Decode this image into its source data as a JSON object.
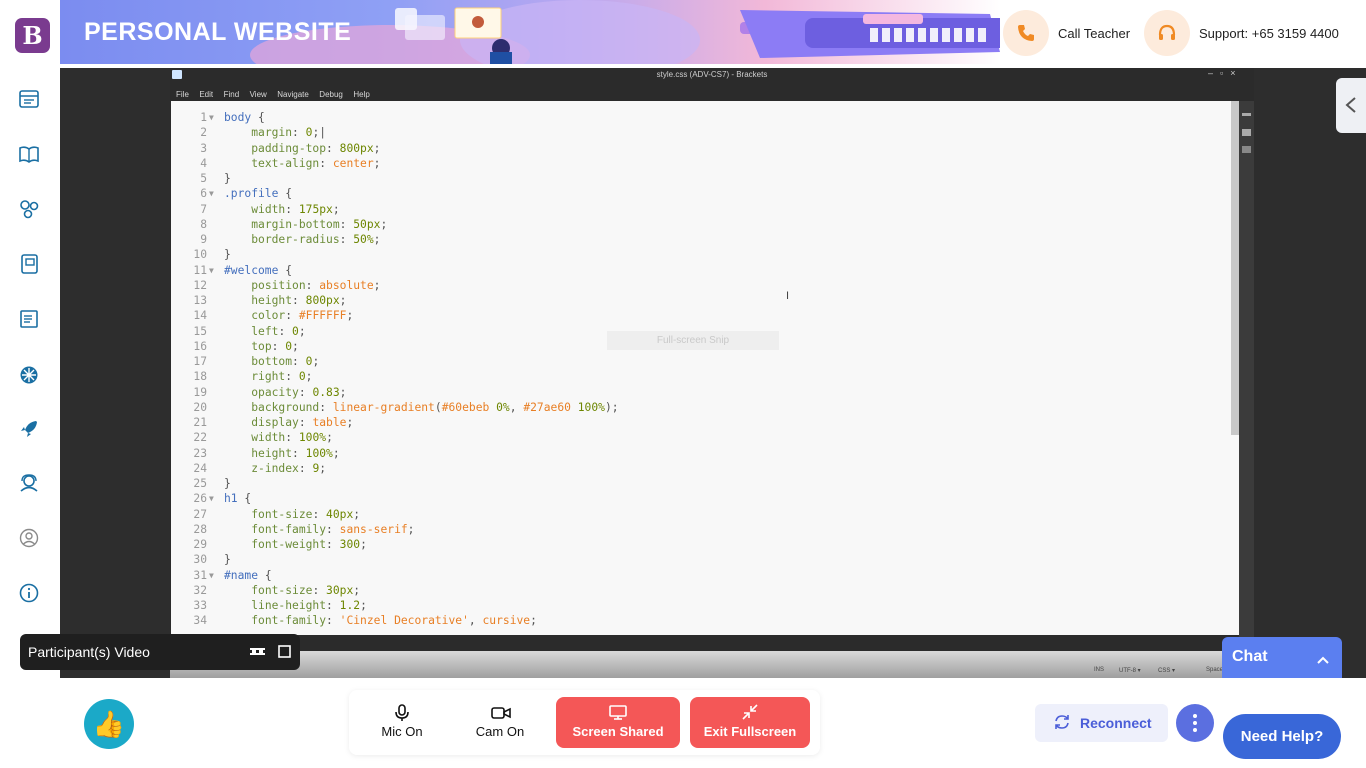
{
  "header": {
    "banner_title": "PERSONAL WEBSITE",
    "call_teacher_label": "Call Teacher",
    "support_label": "Support: +65 3159 4400"
  },
  "sidebar": {
    "items": [
      {
        "icon": "dashboard-icon"
      },
      {
        "icon": "book-icon"
      },
      {
        "icon": "cells-icon"
      },
      {
        "icon": "notebook-icon"
      },
      {
        "icon": "document-list-icon"
      },
      {
        "icon": "snowflake-icon"
      },
      {
        "icon": "rocket-icon"
      },
      {
        "icon": "support-agent-icon"
      },
      {
        "icon": "profile-icon"
      },
      {
        "icon": "info-icon"
      }
    ]
  },
  "brackets": {
    "window_title": "style.css (ADV-CS7) - Brackets",
    "menu": [
      "File",
      "Edit",
      "Find",
      "View",
      "Navigate",
      "Debug",
      "Help"
    ],
    "status": {
      "ins": "INS",
      "encoding": "UTF-8 ▾",
      "language": "CSS ▾",
      "spaces": "Space"
    },
    "snip_overlay": "Full-screen Snip"
  },
  "code_lines": [
    {
      "n": "1",
      "fold": "▼",
      "tokens": [
        [
          "sel",
          "body "
        ],
        [
          "punct",
          "{"
        ]
      ]
    },
    {
      "n": "2",
      "fold": "",
      "tokens": [
        [
          "punct",
          "    "
        ],
        [
          "prop",
          "margin"
        ],
        [
          "punct",
          ": "
        ],
        [
          "num",
          "0"
        ],
        [
          "punct",
          ";|"
        ]
      ]
    },
    {
      "n": "3",
      "fold": "",
      "tokens": [
        [
          "punct",
          "    "
        ],
        [
          "prop",
          "padding-top"
        ],
        [
          "punct",
          ": "
        ],
        [
          "num",
          "800px"
        ],
        [
          "punct",
          ";"
        ]
      ]
    },
    {
      "n": "4",
      "fold": "",
      "tokens": [
        [
          "punct",
          "    "
        ],
        [
          "prop",
          "text-align"
        ],
        [
          "punct",
          ": "
        ],
        [
          "kw",
          "center"
        ],
        [
          "punct",
          ";"
        ]
      ]
    },
    {
      "n": "5",
      "fold": "",
      "tokens": [
        [
          "punct",
          "}"
        ]
      ]
    },
    {
      "n": "6",
      "fold": "▼",
      "tokens": [
        [
          "sel",
          ".profile "
        ],
        [
          "punct",
          "{"
        ]
      ]
    },
    {
      "n": "7",
      "fold": "",
      "tokens": [
        [
          "punct",
          "    "
        ],
        [
          "prop",
          "width"
        ],
        [
          "punct",
          ": "
        ],
        [
          "num",
          "175px"
        ],
        [
          "punct",
          ";"
        ]
      ]
    },
    {
      "n": "8",
      "fold": "",
      "tokens": [
        [
          "punct",
          "    "
        ],
        [
          "prop",
          "margin-bottom"
        ],
        [
          "punct",
          ": "
        ],
        [
          "num",
          "50px"
        ],
        [
          "punct",
          ";"
        ]
      ]
    },
    {
      "n": "9",
      "fold": "",
      "tokens": [
        [
          "punct",
          "    "
        ],
        [
          "prop",
          "border-radius"
        ],
        [
          "punct",
          ": "
        ],
        [
          "num",
          "50%"
        ],
        [
          "punct",
          ";"
        ]
      ]
    },
    {
      "n": "10",
      "fold": "",
      "tokens": [
        [
          "punct",
          "}"
        ]
      ]
    },
    {
      "n": "11",
      "fold": "▼",
      "tokens": [
        [
          "sel",
          "#welcome "
        ],
        [
          "punct",
          "{"
        ]
      ]
    },
    {
      "n": "12",
      "fold": "",
      "tokens": [
        [
          "punct",
          "    "
        ],
        [
          "prop",
          "position"
        ],
        [
          "punct",
          ": "
        ],
        [
          "kw",
          "absolute"
        ],
        [
          "punct",
          ";"
        ]
      ]
    },
    {
      "n": "13",
      "fold": "",
      "tokens": [
        [
          "punct",
          "    "
        ],
        [
          "prop",
          "height"
        ],
        [
          "punct",
          ": "
        ],
        [
          "num",
          "800px"
        ],
        [
          "punct",
          ";"
        ]
      ]
    },
    {
      "n": "14",
      "fold": "",
      "tokens": [
        [
          "punct",
          "    "
        ],
        [
          "prop",
          "color"
        ],
        [
          "punct",
          ": "
        ],
        [
          "str",
          "#FFFFFF"
        ],
        [
          "punct",
          ";"
        ]
      ]
    },
    {
      "n": "15",
      "fold": "",
      "tokens": [
        [
          "punct",
          "    "
        ],
        [
          "prop",
          "left"
        ],
        [
          "punct",
          ": "
        ],
        [
          "num",
          "0"
        ],
        [
          "punct",
          ";"
        ]
      ]
    },
    {
      "n": "16",
      "fold": "",
      "tokens": [
        [
          "punct",
          "    "
        ],
        [
          "prop",
          "top"
        ],
        [
          "punct",
          ": "
        ],
        [
          "num",
          "0"
        ],
        [
          "punct",
          ";"
        ]
      ]
    },
    {
      "n": "17",
      "fold": "",
      "tokens": [
        [
          "punct",
          "    "
        ],
        [
          "prop",
          "bottom"
        ],
        [
          "punct",
          ": "
        ],
        [
          "num",
          "0"
        ],
        [
          "punct",
          ";"
        ]
      ]
    },
    {
      "n": "18",
      "fold": "",
      "tokens": [
        [
          "punct",
          "    "
        ],
        [
          "prop",
          "right"
        ],
        [
          "punct",
          ": "
        ],
        [
          "num",
          "0"
        ],
        [
          "punct",
          ";"
        ]
      ]
    },
    {
      "n": "19",
      "fold": "",
      "tokens": [
        [
          "punct",
          "    "
        ],
        [
          "prop",
          "opacity"
        ],
        [
          "punct",
          ": "
        ],
        [
          "num",
          "0.83"
        ],
        [
          "punct",
          ";"
        ]
      ]
    },
    {
      "n": "20",
      "fold": "",
      "tokens": [
        [
          "punct",
          "    "
        ],
        [
          "prop",
          "background"
        ],
        [
          "punct",
          ": "
        ],
        [
          "kw",
          "linear-gradient"
        ],
        [
          "punct",
          "("
        ],
        [
          "str",
          "#60ebeb"
        ],
        [
          "num",
          " 0%"
        ],
        [
          "punct",
          ", "
        ],
        [
          "str",
          "#27ae60"
        ],
        [
          "num",
          " 100%"
        ],
        [
          "punct",
          ");"
        ]
      ]
    },
    {
      "n": "21",
      "fold": "",
      "tokens": [
        [
          "punct",
          "    "
        ],
        [
          "prop",
          "display"
        ],
        [
          "punct",
          ": "
        ],
        [
          "kw",
          "table"
        ],
        [
          "punct",
          ";"
        ]
      ]
    },
    {
      "n": "22",
      "fold": "",
      "tokens": [
        [
          "punct",
          "    "
        ],
        [
          "prop",
          "width"
        ],
        [
          "punct",
          ": "
        ],
        [
          "num",
          "100%"
        ],
        [
          "punct",
          ";"
        ]
      ]
    },
    {
      "n": "23",
      "fold": "",
      "tokens": [
        [
          "punct",
          "    "
        ],
        [
          "prop",
          "height"
        ],
        [
          "punct",
          ": "
        ],
        [
          "num",
          "100%"
        ],
        [
          "punct",
          ";"
        ]
      ]
    },
    {
      "n": "24",
      "fold": "",
      "tokens": [
        [
          "punct",
          "    "
        ],
        [
          "prop",
          "z-index"
        ],
        [
          "punct",
          ": "
        ],
        [
          "num",
          "9"
        ],
        [
          "punct",
          ";"
        ]
      ]
    },
    {
      "n": "25",
      "fold": "",
      "tokens": [
        [
          "punct",
          "}"
        ]
      ]
    },
    {
      "n": "26",
      "fold": "▼",
      "tokens": [
        [
          "sel",
          "h1 "
        ],
        [
          "punct",
          "{"
        ]
      ]
    },
    {
      "n": "27",
      "fold": "",
      "tokens": [
        [
          "punct",
          "    "
        ],
        [
          "prop",
          "font-size"
        ],
        [
          "punct",
          ": "
        ],
        [
          "num",
          "40px"
        ],
        [
          "punct",
          ";"
        ]
      ]
    },
    {
      "n": "28",
      "fold": "",
      "tokens": [
        [
          "punct",
          "    "
        ],
        [
          "prop",
          "font-family"
        ],
        [
          "punct",
          ": "
        ],
        [
          "kw",
          "sans-serif"
        ],
        [
          "punct",
          ";"
        ]
      ]
    },
    {
      "n": "29",
      "fold": "",
      "tokens": [
        [
          "punct",
          "    "
        ],
        [
          "prop",
          "font-weight"
        ],
        [
          "punct",
          ": "
        ],
        [
          "num",
          "300"
        ],
        [
          "punct",
          ";"
        ]
      ]
    },
    {
      "n": "30",
      "fold": "",
      "tokens": [
        [
          "punct",
          "}"
        ]
      ]
    },
    {
      "n": "31",
      "fold": "▼",
      "tokens": [
        [
          "sel",
          "#name "
        ],
        [
          "punct",
          "{"
        ]
      ]
    },
    {
      "n": "32",
      "fold": "",
      "tokens": [
        [
          "punct",
          "    "
        ],
        [
          "prop",
          "font-size"
        ],
        [
          "punct",
          ": "
        ],
        [
          "num",
          "30px"
        ],
        [
          "punct",
          ";"
        ]
      ]
    },
    {
      "n": "33",
      "fold": "",
      "tokens": [
        [
          "punct",
          "    "
        ],
        [
          "prop",
          "line-height"
        ],
        [
          "punct",
          ": "
        ],
        [
          "num",
          "1.2"
        ],
        [
          "punct",
          ";"
        ]
      ]
    },
    {
      "n": "34",
      "fold": "",
      "tokens": [
        [
          "punct",
          "    "
        ],
        [
          "prop",
          "font-family"
        ],
        [
          "punct",
          ": "
        ],
        [
          "str",
          "'Cinzel Decorative'"
        ],
        [
          "punct",
          ", "
        ],
        [
          "kw",
          "cursive"
        ],
        [
          "punct",
          ";"
        ]
      ]
    }
  ],
  "participant": {
    "label": "Participant(s) Video"
  },
  "controls": {
    "mic_label": "Mic On",
    "cam_label": "Cam On",
    "screen_label": "Screen Shared",
    "exit_label": "Exit Fullscreen",
    "reconnect_label": "Reconnect",
    "chat_label": "Chat",
    "help_label": "Need Help?"
  },
  "colors": {
    "accent_red": "#f45757",
    "accent_blue": "#5b7ff0",
    "help_blue": "#3967d8",
    "brand_purple": "#7a3b8f"
  }
}
